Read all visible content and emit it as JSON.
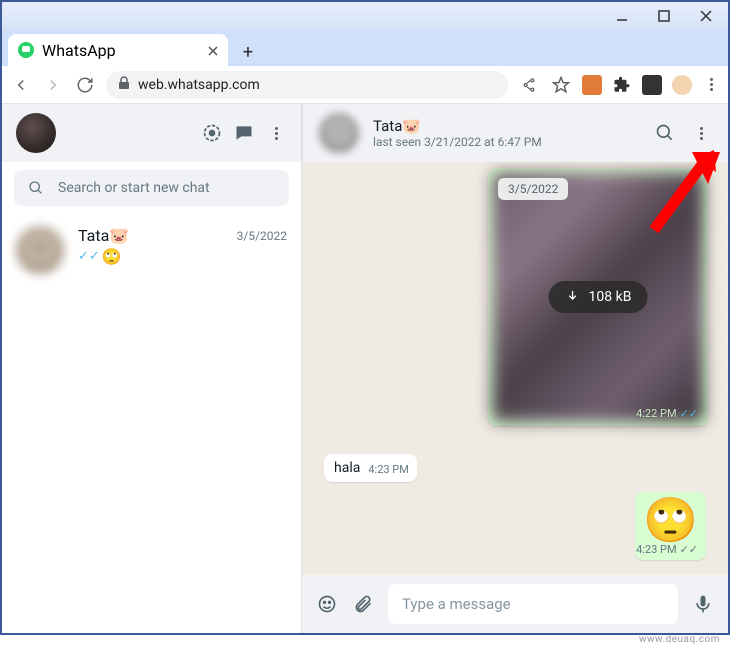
{
  "browser": {
    "tab_title": "WhatsApp",
    "url": "web.whatsapp.com"
  },
  "left_panel": {
    "search_placeholder": "Search or start new chat"
  },
  "chat_preview": {
    "name": "Tata🐷",
    "date": "3/5/2022",
    "emoji": "🙄"
  },
  "conversation_header": {
    "name": "Tata🐷",
    "status": "last seen 3/21/2022 at 6:47 PM"
  },
  "messages": {
    "image_msg": {
      "date_badge": "3/5/2022",
      "download_size": "108 kB",
      "time": "4:22 PM"
    },
    "incoming": {
      "text": "hala",
      "time": "4:23 PM"
    },
    "emoji_msg": {
      "emoji": "🙄",
      "time": "4:23 PM"
    }
  },
  "composer": {
    "placeholder": "Type a message"
  },
  "watermark": "www.deuaq.com"
}
